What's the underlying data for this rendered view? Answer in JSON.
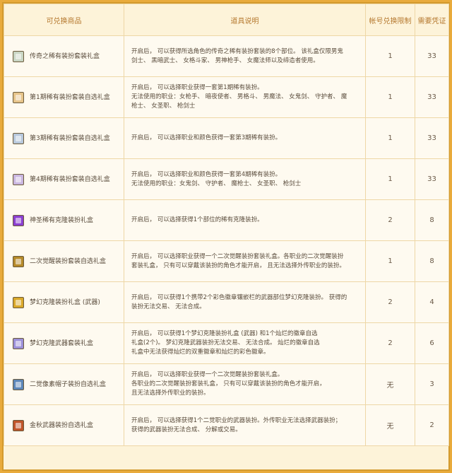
{
  "header": {
    "col_item": "可兑换商品",
    "col_desc": "道具说明",
    "col_limit": "帐号兑换限制",
    "col_cost": "需要凭证"
  },
  "rows": [
    {
      "name": "传奇之稀有装扮套装礼盒",
      "icon": "gift-box-icon",
      "icon_color": "#c9d6c4",
      "desc": [
        "开启后， 可以获得所选角色的传奇之稀有装扮套装的8个部位。 该礼盒仅限男鬼",
        "剑士、 黑暗武士、 女格斗家、 男神枪手、 女魔法师以及缔造者使用。"
      ],
      "limit": "1",
      "cost": "33"
    },
    {
      "name": "第1期稀有装扮套装自选礼盒",
      "icon": "gift-box-icon",
      "icon_color": "#e6c48a",
      "desc": [
        "开启后， 可以选择职业获得一套第1期稀有装扮。",
        "无法使用的职业：女枪手、 暗夜使者、 男格斗、 男魔法、 女鬼剑、 守护者、 魔",
        "枪士、 女圣职、 枪剑士"
      ],
      "limit": "1",
      "cost": "33"
    },
    {
      "name": "第3期稀有装扮套装自选礼盒",
      "icon": "gift-box-icon",
      "icon_color": "#b7c8dc",
      "desc": [
        "开启后， 可以选择职业和颜色获得一套第3期稀有装扮。"
      ],
      "limit": "1",
      "cost": "33"
    },
    {
      "name": "第4期稀有装扮套装自选礼盒",
      "icon": "gift-box-icon",
      "icon_color": "#c9b6e0",
      "desc": [
        "开启后， 可以选择职业和颜色获得一套第4期稀有装扮。",
        "无法使用的职业：女鬼剑、 守护者、 魔枪士、 女圣职、 枪剑士"
      ],
      "limit": "1",
      "cost": "33"
    },
    {
      "name": "神圣稀有克隆装扮礼盒",
      "icon": "purple-box-icon",
      "icon_color": "#8a3fd0",
      "desc": [
        "开启后， 可以选择获得1个部位的稀有克隆装扮。"
      ],
      "limit": "2",
      "cost": "8"
    },
    {
      "name": "二次觉醒装扮套装自选礼盒",
      "icon": "gold-box-icon",
      "icon_color": "#b58a2a",
      "desc": [
        "开启后， 可以选择职业获得一个二次觉醒装扮套装礼盒。各职业的二次觉醒装扮",
        "套装礼盒， 只有可以穿戴该装扮的角色才能开启， 且无法选择外传职业的装扮。"
      ],
      "limit": "1",
      "cost": "8"
    },
    {
      "name": "梦幻克隆装扮礼盒 (武器)",
      "icon": "weapon-box-icon",
      "icon_color": "#d9a82a",
      "desc": [
        "开启后， 可以获得1个携带2个彩色徽章镶嵌栏的武器部位梦幻克隆装扮。 获得的",
        "装扮无法交易、 无法合成。"
      ],
      "limit": "2",
      "cost": "4"
    },
    {
      "name": "梦幻克隆武器套装礼盒",
      "icon": "sword-icon",
      "icon_color": "#9b8fd8",
      "desc": [
        "开启后， 可以获得1个梦幻克隆装扮礼盒 (武器) 和1个灿烂的徽章自选",
        "礼盒(2个)。 梦幻克隆武器装扮无法交易、 无法合成。 灿烂的徽章自选",
        "礼盒中无法获得灿烂的双重徽章和灿烂的彩色徽章。"
      ],
      "limit": "2",
      "cost": "6"
    },
    {
      "name": "二觉像素帽子装扮自选礼盒",
      "icon": "pixel-hat-icon",
      "icon_color": "#5b86b8",
      "desc": [
        "开启后， 可以选择职业获得一个二次觉醒装扮套装礼盒。",
        "各职业的二次觉醒装扮套装礼盒， 只有可以穿戴该装扮的角色才能开启，",
        "且无法选择外传职业的装扮。"
      ],
      "limit": "无",
      "cost": "3"
    },
    {
      "name": "金秋武器装扮自选礼盒",
      "icon": "autumn-weapon-box-icon",
      "icon_color": "#c0552a",
      "desc": [
        "开启后， 可以选择获得1个二觉职业的武器装扮。外传职业无法选择武器装扮；",
        "获得的武器装扮无法合成、 分解或交易。"
      ],
      "limit": "无",
      "cost": "2"
    }
  ]
}
